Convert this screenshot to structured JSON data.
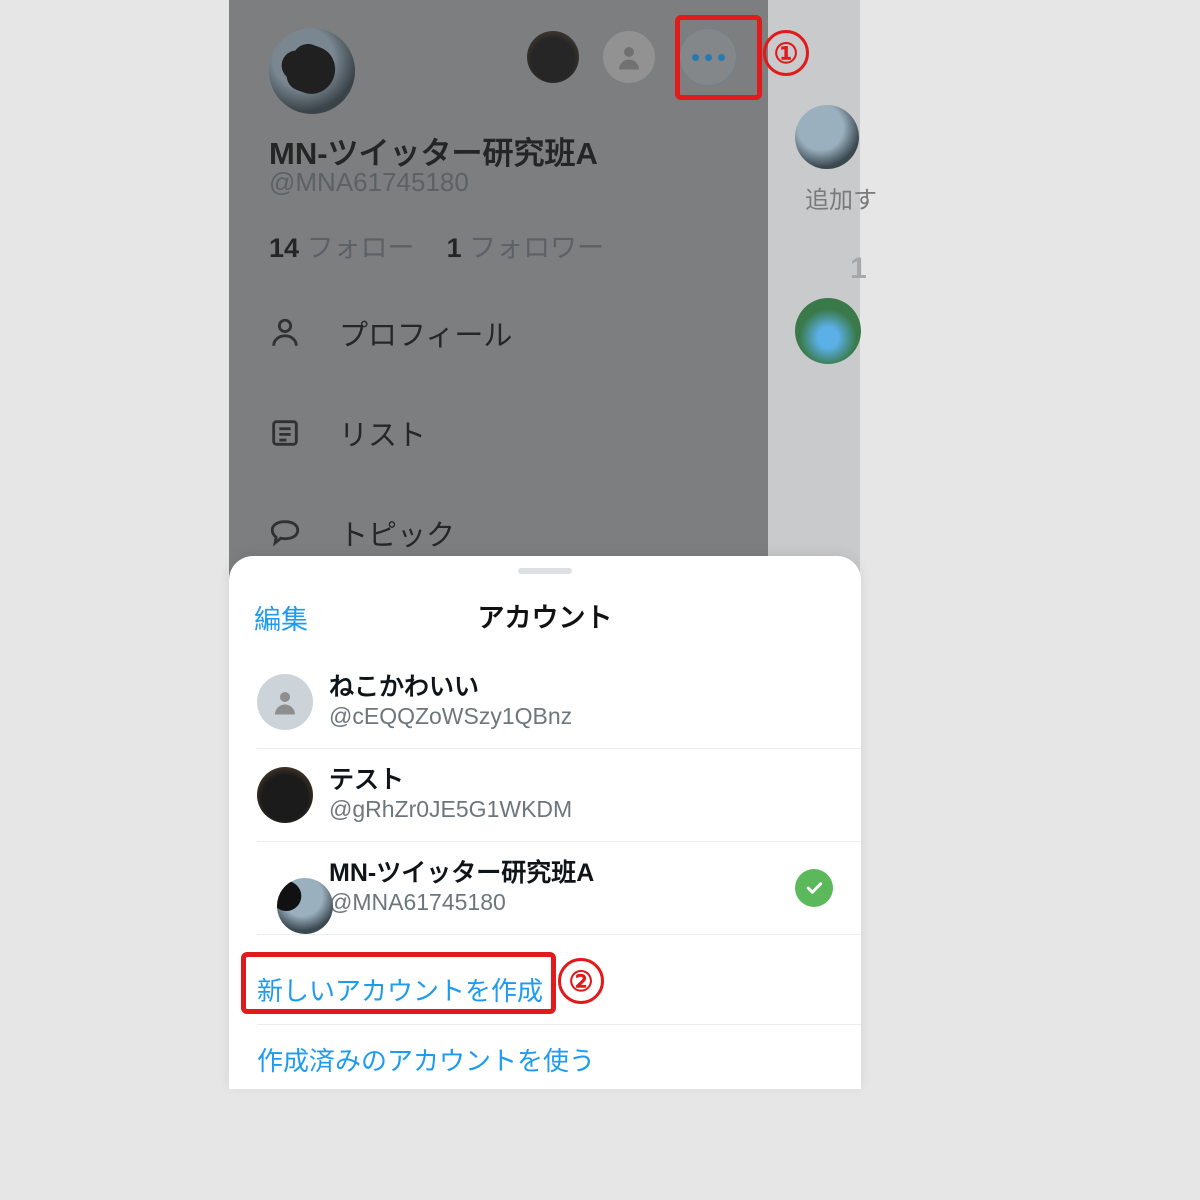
{
  "drawer": {
    "display_name": "MN-ツイッター研究班A",
    "handle": "@MNA61745180",
    "following_count": "14",
    "following_label": "フォロー",
    "followers_count": "1",
    "followers_label": "フォロワー",
    "menu": {
      "profile": "プロフィール",
      "list": "リスト",
      "topic": "トピック"
    }
  },
  "right_strip": {
    "add_label": "追加す",
    "number": "1"
  },
  "sheet": {
    "edit": "編集",
    "title": "アカウント",
    "accounts": [
      {
        "name": "ねこかわいい",
        "handle": "@cEQQZoWSzy1QBnz",
        "selected": false,
        "avatar": "gray"
      },
      {
        "name": "テスト",
        "handle": "@gRhZr0JE5G1WKDM",
        "selected": false,
        "avatar": "cat"
      },
      {
        "name": "MN-ツイッター研究班A",
        "handle": "@MNA61745180",
        "selected": true,
        "avatar": "bird"
      }
    ],
    "create_new": "新しいアカウントを作成",
    "use_existing": "作成済みのアカウントを使う"
  },
  "annotations": {
    "one": "①",
    "two": "②"
  }
}
